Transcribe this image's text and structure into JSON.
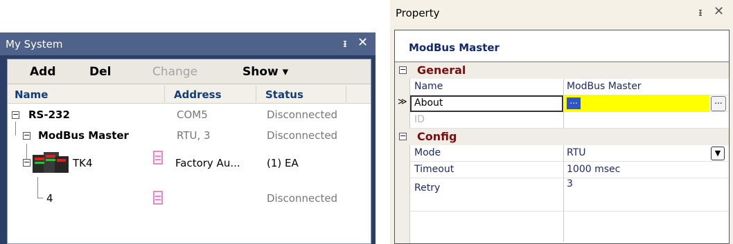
{
  "my_system": {
    "title": "My System",
    "toolbar": {
      "add": "Add",
      "del": "Del",
      "change": "Change",
      "show": "Show ▾"
    },
    "columns": {
      "name": "Name",
      "address": "Address",
      "status": "Status"
    },
    "rows": [
      {
        "name": "RS-232",
        "address": "COM5",
        "status": "Disconnected"
      },
      {
        "name": "ModBus Master",
        "address": "RTU, 3",
        "status": "Disconnected"
      },
      {
        "name": "TK4",
        "address": "Factory Au...",
        "status": "(1) EA"
      },
      {
        "name": "4",
        "address": "",
        "status": "Disconnected"
      }
    ]
  },
  "property": {
    "title": "Property",
    "object_name": "ModBus Master",
    "categories": {
      "general": "General",
      "config": "Config"
    },
    "general": [
      {
        "key": "Name",
        "value": "ModBus Master"
      },
      {
        "key": "About",
        "value": "..."
      },
      {
        "key": "ID",
        "value": ""
      }
    ],
    "config": [
      {
        "key": "Mode",
        "value": "RTU"
      },
      {
        "key": "Timeout",
        "value": "1000 msec"
      },
      {
        "key": "Retry",
        "value": "3"
      }
    ],
    "ellipsis_button": "...",
    "dropdown_glyph": "▼"
  },
  "icons": {
    "pin": "pin-icon",
    "close": "close-icon",
    "expand_collapse": "minus-box-icon",
    "device": "temperature-controller-icon",
    "document": "document-icon",
    "selected_marker": "double-chevron-icon"
  },
  "colors": {
    "panel_title_bg": "#4f6289",
    "category_text": "#7a0d10",
    "selected_value_bg": "#ffff00",
    "header_text": "#113d7a"
  }
}
